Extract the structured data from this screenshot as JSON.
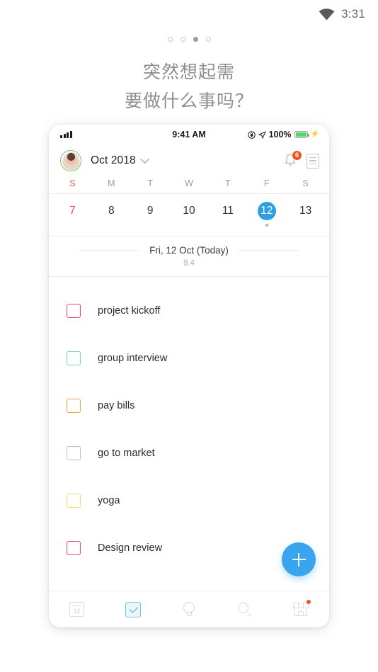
{
  "os_status": {
    "icon": "wifi-icon",
    "time": "3:31"
  },
  "pager": {
    "count": 4,
    "active_index": 2
  },
  "headline": {
    "line1": "突然想起需",
    "line2": "要做什么事吗？"
  },
  "phone": {
    "ios_status": {
      "signal_icon": "signal-bars-icon",
      "time": "9:41 AM",
      "rotation_lock_icon": "rotation-lock-icon",
      "location_icon": "location-arrow-icon",
      "battery_percent": "100%",
      "battery_icon": "battery-icon",
      "charging_icon": "lightning-bolt-icon"
    },
    "header": {
      "avatar": "user-avatar",
      "month": "Oct 2018",
      "chevron_icon": "chevron-down-icon",
      "bell_icon": "bell-icon",
      "bell_badge": "6",
      "list_icon": "document-list-icon"
    },
    "calendar": {
      "weekdays": [
        "S",
        "M",
        "T",
        "W",
        "T",
        "F",
        "S"
      ],
      "days": [
        {
          "num": "7",
          "sunday": true,
          "selected": false,
          "dot": false
        },
        {
          "num": "8",
          "sunday": false,
          "selected": false,
          "dot": false
        },
        {
          "num": "9",
          "sunday": false,
          "selected": false,
          "dot": false
        },
        {
          "num": "10",
          "sunday": false,
          "selected": false,
          "dot": false
        },
        {
          "num": "11",
          "sunday": false,
          "selected": false,
          "dot": false
        },
        {
          "num": "12",
          "sunday": false,
          "selected": true,
          "dot": true
        },
        {
          "num": "13",
          "sunday": false,
          "selected": false,
          "dot": false
        }
      ],
      "selected_color": "#2f9fe3",
      "sunday_color": "#e05b4c"
    },
    "date_header": {
      "title": "Fri, 12 Oct (Today)",
      "subtitle": "9.4"
    },
    "tasks": [
      {
        "label": "project kickoff",
        "color": "#e8477a",
        "checked": false
      },
      {
        "label": "group interview",
        "color": "#7ecfc0",
        "checked": false
      },
      {
        "label": "pay bills",
        "color": "#efa63c",
        "checked": false
      },
      {
        "label": "go to market",
        "color": "#b8c0cc",
        "checked": false
      },
      {
        "label": "yoga",
        "color": "#f2dd68",
        "checked": false
      },
      {
        "label": "Design review",
        "color": "#e8477a",
        "checked": false
      }
    ],
    "fab": {
      "icon": "plus-icon",
      "color": "#3aa5ef"
    },
    "nav": [
      {
        "name": "calendar",
        "icon": "calendar-12-icon",
        "label": "12",
        "active": false,
        "badge": false
      },
      {
        "name": "tasks",
        "icon": "checkbox-icon",
        "label": "",
        "active": true,
        "badge": false
      },
      {
        "name": "ideas",
        "icon": "lightbulb-icon",
        "label": "",
        "active": false,
        "badge": false
      },
      {
        "name": "search",
        "icon": "search-icon",
        "label": "",
        "active": false,
        "badge": false
      },
      {
        "name": "store",
        "icon": "storefront-icon",
        "label": "",
        "active": false,
        "badge": true
      }
    ]
  }
}
